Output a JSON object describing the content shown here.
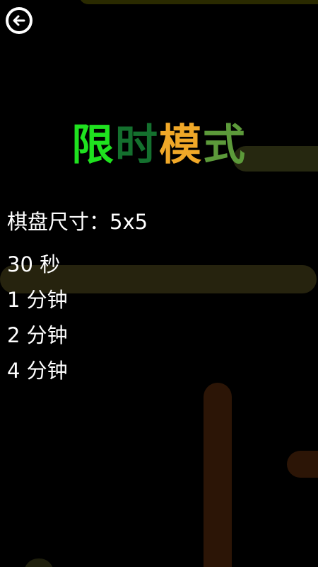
{
  "nav": {
    "back_icon": "back-arrow-icon"
  },
  "title": {
    "chars": [
      "限",
      "时",
      "模",
      "式"
    ],
    "colors": [
      "#1fe21f",
      "#14702e",
      "#f0a828",
      "#5c9a3a"
    ]
  },
  "board": {
    "size_text": "棋盘尺寸：5x5"
  },
  "menu": {
    "items": [
      {
        "label": "30 秒"
      },
      {
        "label": "1 分钟"
      },
      {
        "label": "2 分钟"
      },
      {
        "label": "4 分钟"
      }
    ]
  },
  "colors": {
    "background": "#000000",
    "text": "#ffffff",
    "bar_yellow": "#26230e",
    "bar_brown": "#2c1506"
  }
}
